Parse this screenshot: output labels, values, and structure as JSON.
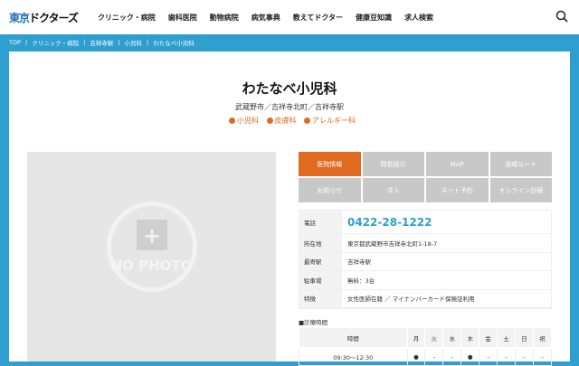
{
  "header": {
    "logo_blue": "東京",
    "logo_black": "ドクターズ",
    "nav": [
      "クリニック・病院",
      "歯科医院",
      "動物病院",
      "病気事典",
      "教えてドクター",
      "健康豆知識",
      "求人検索"
    ]
  },
  "breadcrumb": [
    "TOP",
    "|",
    "クリニック・病院",
    "|",
    "吉祥寺駅",
    "|",
    "小児科",
    "|",
    "わたなべ小児科"
  ],
  "clinic": {
    "name": "わたなべ小児科",
    "location": "武蔵野市／吉祥寺北町／吉祥寺駅",
    "departments": [
      "小児科",
      "皮膚科",
      "アレルギー科"
    ]
  },
  "photo": {
    "placeholder": "NO PHOTO"
  },
  "tabs": [
    "医院情報",
    "院長紹介",
    "MAP",
    "道順ルート",
    "お知らせ",
    "求人",
    "ネット予約",
    "オンライン診療"
  ],
  "info": [
    {
      "label": "電話",
      "value": "0422-28-1222"
    },
    {
      "label": "所在地",
      "value": "東京都武蔵野市吉祥寺北町1-18-7"
    },
    {
      "label": "最寄駅",
      "value": "吉祥寺駅"
    },
    {
      "label": "駐車場",
      "value": "無料：3台"
    },
    {
      "label": "特徴",
      "value": "女性医師在籍 ／ マイナンバーカード保険証利用"
    }
  ],
  "hours": {
    "heading": "■診療時間",
    "columns": [
      "時間",
      "月",
      "火",
      "水",
      "木",
      "金",
      "土",
      "日",
      "祝"
    ],
    "rows": [
      [
        "09:30〜12:30",
        "●",
        "-",
        "-",
        "●",
        "-",
        "-",
        "-",
        "-"
      ]
    ]
  }
}
